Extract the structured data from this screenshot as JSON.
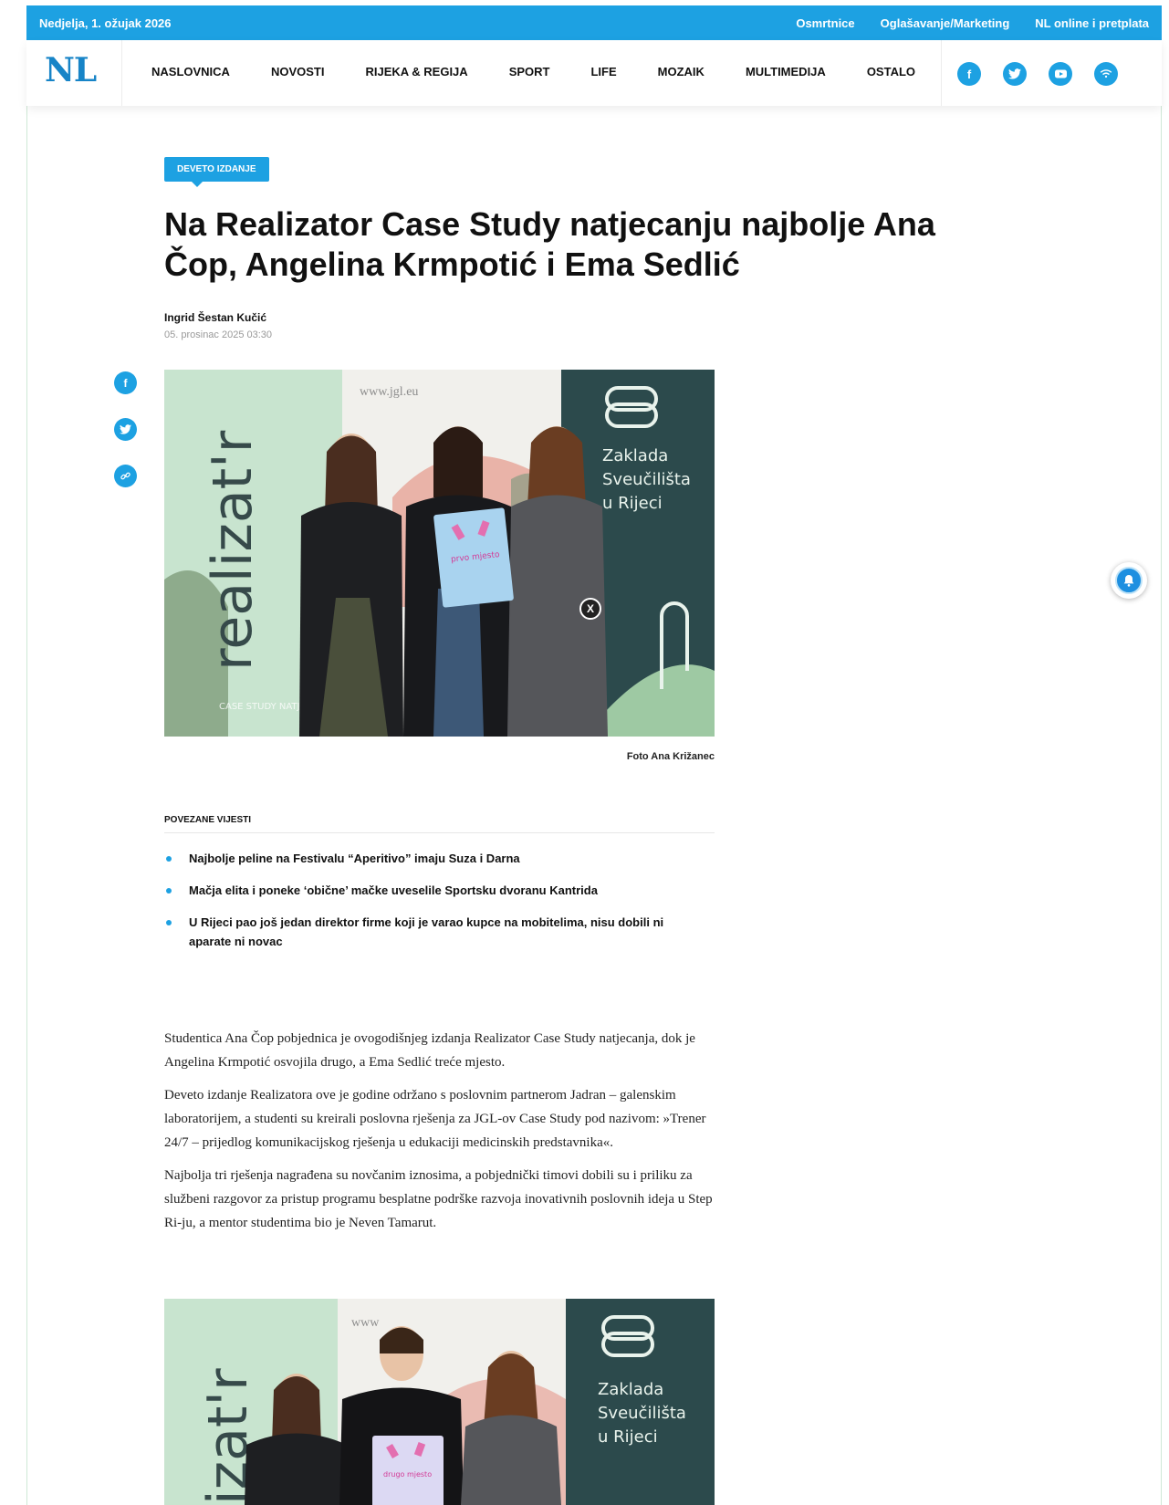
{
  "topbar": {
    "date": "Nedjelja, 1. ožujak 2026",
    "links": [
      "Osmrtnice",
      "Oglašavanje/Marketing",
      "NL online i pretplata"
    ]
  },
  "nav": {
    "logo": "NL",
    "menu": [
      "NASLOVNICA",
      "NOVOSTI",
      "RIJEKA & REGIJA",
      "SPORT",
      "LIFE",
      "MOZAIK",
      "MULTIMEDIJA",
      "OSTALO"
    ],
    "socials": [
      "facebook-icon",
      "twitter-icon",
      "youtube-icon",
      "rss-icon"
    ]
  },
  "article": {
    "tag": "DEVETO IZDANJE",
    "title": "Na Realizator Case Study natjecanju najbolje Ana Čop, Angelina Krmpotić i Ema Sedlić",
    "author": "Ingrid Šestan Kučić",
    "date": "05. prosinac 2025 03:30",
    "photo": {
      "banner_word": "realizat'r",
      "banner_sub": "CASE STUDY NATJECANJE ZAKLADE",
      "url": "www.jgl.eu",
      "foundation": [
        "Zaklada",
        "Sveučilišta",
        "u Rijeci"
      ],
      "certificate": "prvo mjesto",
      "close": "X"
    },
    "photo2": {
      "banner_word": "izat'r",
      "url": "www",
      "foundation": [
        "Zaklada",
        "Sveučilišta",
        "u Rijeci"
      ],
      "certificate": "drugo mjesto"
    },
    "caption": "Foto Ana Križanec"
  },
  "related": {
    "heading": "POVEZANE VIJESTI",
    "items": [
      "Najbolje peline na Festivalu “Aperitivo” imaju Suza i Darna",
      "Mačja elita i poneke ‘obične’ mačke uveselile Sportsku dvoranu Kantrida",
      "U Rijeci pao još jedan direktor firme koji je varao kupce na mobitelima, nisu dobili ni aparate ni novac"
    ]
  },
  "body": [
    "Studentica Ana Čop pobjednica je ovogodišnjeg izdanja Realizator Case Study natjecanja, dok je Angelina Krmpotić osvojila drugo, a Ema Sedlić treće mjesto.",
    "Deveto izdanje Realizatora ove je godine održano s poslovnim partnerom Jadran – galenskim laboratorijem, a studenti su kreirali poslovna rješenja za JGL-ov Case Study pod nazivom: »Trener 24/7 – prijedlog komunikacijskog rješenja u edukaciji medicinskih predstavnika«.",
    "Najbolja tri rješenja nagrađena su novčanim iznosima, a pobjednički timovi dobili su i priliku za službeni razgovor za pristup programu besplatne podrške razvoja inovativnih poslovnih ideja u Step Ri-ju, a mentor studentima bio je Neven Tamarut."
  ],
  "colors": {
    "accent": "#1da1e2",
    "logo": "#1784c7"
  }
}
